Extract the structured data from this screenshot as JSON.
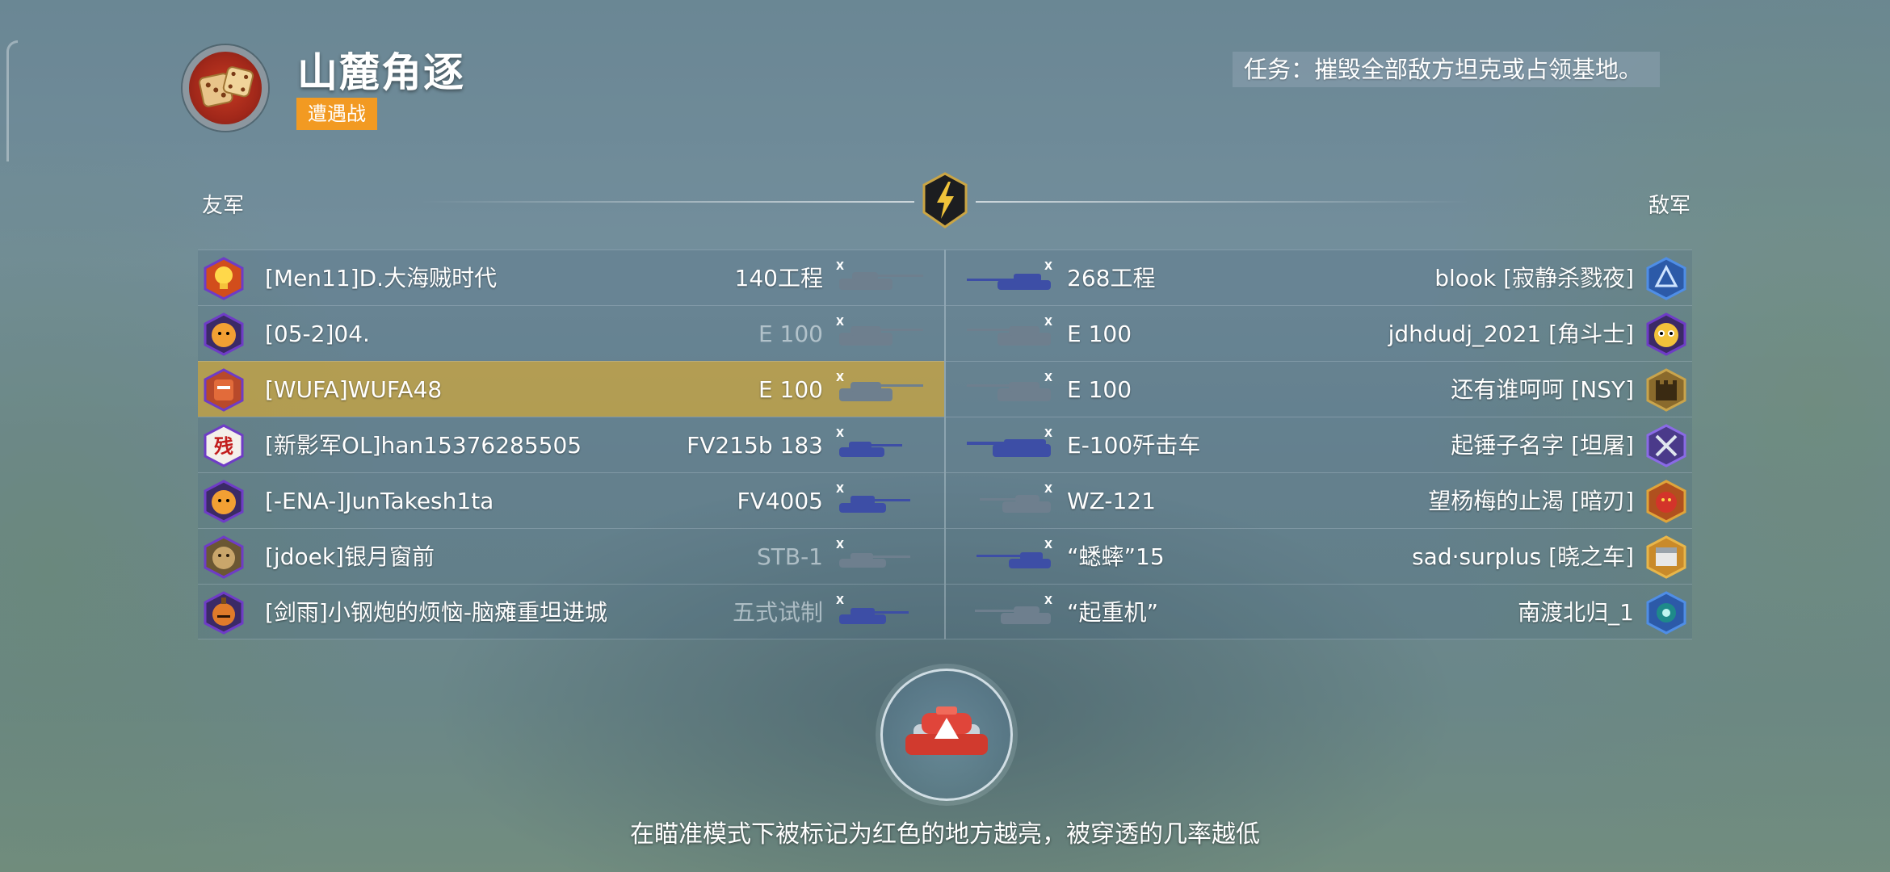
{
  "header": {
    "map_name": "山麓角逐",
    "mode_label": "遭遇战",
    "mission_text": "任务：摧毁全部敌方坦克或占领基地。"
  },
  "teams": {
    "allies_label": "友军",
    "enemies_label": "敌军"
  },
  "allies": [
    {
      "player": "[Men11]D.大海贼时代",
      "vehicle": "140工程",
      "destroyed": false,
      "avatar": "lightbulb-icon",
      "tank_color": "#6e7f8e"
    },
    {
      "player": "[05-2]04.",
      "vehicle": "E 100",
      "destroyed": true,
      "avatar": "angry-fist-icon",
      "tank_color": "#6e7f8e"
    },
    {
      "player": "[WUFA]WUFA48",
      "vehicle": "E 100",
      "destroyed": false,
      "self": true,
      "avatar": "samurai-mask-icon",
      "tank_color": "#6e7f8e"
    },
    {
      "player": "[新影军OL]han15376285505",
      "vehicle": "FV215b 183",
      "destroyed": false,
      "avatar": "calligraphy-char-icon",
      "tank_color": "#3d4ea6"
    },
    {
      "player": "[-ENA-]JunTakesh1ta",
      "vehicle": "FV4005",
      "destroyed": false,
      "avatar": "angry-fist-icon",
      "tank_color": "#3d4ea6"
    },
    {
      "player": "[jdoek]银月窗前",
      "vehicle": "STB-1",
      "destroyed": true,
      "avatar": "beast-head-icon",
      "tank_color": "#6e7f8e"
    },
    {
      "player": "[剑雨]小钢炮的烦恼-脑瘫重坦进城",
      "vehicle": "五式试制",
      "destroyed": true,
      "avatar": "bomb-face-icon",
      "tank_color": "#3d4ea6"
    }
  ],
  "enemies": [
    {
      "player": "blook [寂静杀戮夜]",
      "vehicle": "268工程",
      "destroyed": false,
      "avatar": "tri-emblem-icon",
      "tank_color": "#3d4ea6"
    },
    {
      "player": "jdhdudj_2021 [角斗士]",
      "vehicle": "E 100",
      "destroyed": false,
      "avatar": "owl-face-icon",
      "tank_color": "#6e7f8e"
    },
    {
      "player": "还有谁呵呵 [NSY]",
      "vehicle": "E 100",
      "destroyed": false,
      "avatar": "fortress-icon",
      "tank_color": "#6e7f8e"
    },
    {
      "player": "起锤子名字 [坦屠]",
      "vehicle": "E-100歼击车",
      "destroyed": false,
      "avatar": "crossed-swords-icon",
      "tank_color": "#3d4ea6"
    },
    {
      "player": "望杨梅的止渴 [暗刃]",
      "vehicle": "WZ-121",
      "destroyed": false,
      "avatar": "dragon-icon",
      "tank_color": "#6e7f8e"
    },
    {
      "player": "sad·surplus [晓之车]",
      "vehicle": "“蟋蟀”15",
      "destroyed": false,
      "avatar": "chest-icon",
      "tank_color": "#3d4ea6"
    },
    {
      "player": "南渡北归_1",
      "vehicle": "“起重机”",
      "destroyed": false,
      "avatar": "hex-eye-icon",
      "tank_color": "#6e7f8e"
    }
  ],
  "colors": {
    "mode_badge": "#f29a22",
    "self_row": "#bea046",
    "light_tank": "#3d4ea6",
    "heavy_tank": "#6e7f8e"
  },
  "tip": "在瞄准模式下被标记为红色的地方越亮，被穿透的几率越低"
}
